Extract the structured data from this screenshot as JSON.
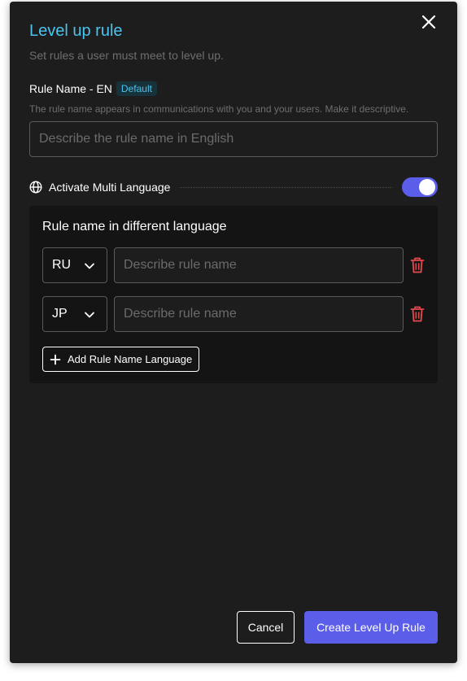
{
  "dialog": {
    "title": "Level up rule",
    "subtitle": "Set rules a user must meet to level up."
  },
  "rule_name": {
    "label": "Rule Name - EN",
    "badge": "Default",
    "helper": "The rule name appears in communications with you and your users. Make it descriptive.",
    "placeholder": "Describe the rule name in English",
    "value": ""
  },
  "multi_language": {
    "label": "Activate Multi Language",
    "enabled": true
  },
  "language_panel": {
    "title": "Rule name in different language",
    "rows": [
      {
        "code": "RU",
        "placeholder": "Describe rule name",
        "value": ""
      },
      {
        "code": "JP",
        "placeholder": "Describe rule name",
        "value": ""
      }
    ],
    "add_label": "Add Rule Name Language"
  },
  "footer": {
    "cancel_label": "Cancel",
    "create_label": "Create Level Up Rule"
  },
  "icons": {
    "close": "close-icon",
    "globe": "globe-icon",
    "chevron": "chevron-down-icon",
    "trash": "trash-icon",
    "plus": "plus-icon"
  },
  "colors": {
    "accent": "#4bc3ef",
    "primary": "#5b5ee8",
    "danger": "#e5484d",
    "background": "#1d1d1d",
    "panel": "#141414"
  }
}
